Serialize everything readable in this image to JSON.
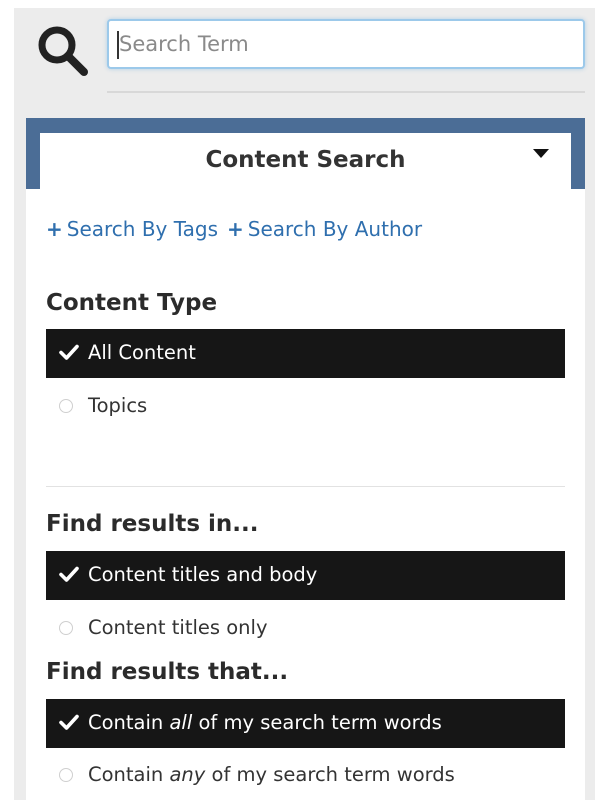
{
  "search": {
    "placeholder": "Search Term",
    "value": ""
  },
  "panel": {
    "title": "Content Search"
  },
  "links": {
    "by_tags": "Search By Tags",
    "by_author": "Search By Author",
    "plus_glyph": "+"
  },
  "content_type": {
    "title": "Content Type",
    "options": [
      {
        "label": "All Content",
        "selected": true
      },
      {
        "label": "Topics",
        "selected": false
      }
    ]
  },
  "find_in": {
    "title": "Find results in...",
    "options": [
      {
        "label": "Content titles and body",
        "selected": true
      },
      {
        "label": "Content titles only",
        "selected": false
      }
    ]
  },
  "find_that": {
    "title": "Find results that...",
    "options": [
      {
        "label_before": "Contain ",
        "label_em": "all",
        "label_after": " of my search term words",
        "selected": true
      },
      {
        "label_before": "Contain ",
        "label_em": "any",
        "label_after": " of my search term words",
        "selected": false
      }
    ]
  },
  "colors": {
    "accent_band": "#4b6d96",
    "link": "#2f6fae",
    "selected_bg": "#161616",
    "input_focus": "#9cc9ea"
  },
  "icons": [
    "search-icon",
    "caret-down-icon",
    "plus-icon",
    "checkmark-icon",
    "radio-empty-icon"
  ]
}
